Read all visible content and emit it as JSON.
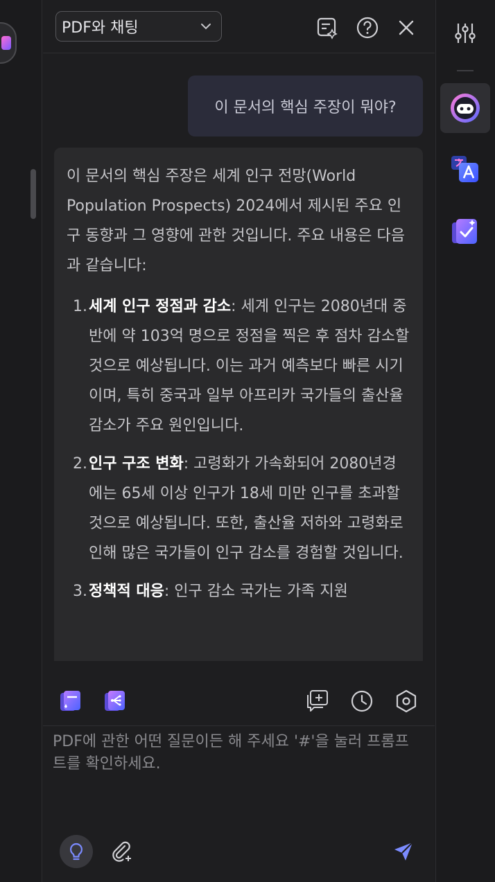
{
  "header": {
    "mode_label": "PDF와 채팅"
  },
  "chat": {
    "user_message": "이 문서의 핵심 주장이 뭐야?",
    "ai_intro": "이 문서의 핵심 주장은 세계 인구 전망(World Population Prospects) 2024에서 제시된 주요 인구 동향과 그 영향에 관한 것입니다. 주요 내용은 다음과 같습니다:",
    "ai_items": [
      {
        "num": "1.",
        "title": "세계 인구 정점과 감소",
        "text": ": 세계 인구는 2080년대 중반에 약 103억 명으로 정점을 찍은 후 점차 감소할 것으로 예상됩니다. 이는 과거 예측보다 빠른 시기이며, 특히 중국과 일부 아프리카 국가들의 출산율 감소가 주요 원인입니다."
      },
      {
        "num": "2.",
        "title": "인구 구조 변화",
        "text": ": 고령화가 가속화되어 2080년경에는 65세 이상 인구가 18세 미만 인구를 초과할 것으로 예상됩니다. 또한, 출산율 저하와 고령화로 인해 많은 국가들이 인구 감소를 경험할 것입니다."
      },
      {
        "num": "3.",
        "title": "정책적 대응",
        "text": ": 인구 감소 국가는 가족 지원"
      }
    ]
  },
  "input": {
    "placeholder": "PDF에 관한 어떤 질문이든 해 주세요 '#'을 눌러 프롬프트를 확인하세요."
  },
  "colors": {
    "accent": "#7b8bff",
    "user_bubble": "#2b2c3a",
    "ai_bubble": "#2a2a2c"
  }
}
